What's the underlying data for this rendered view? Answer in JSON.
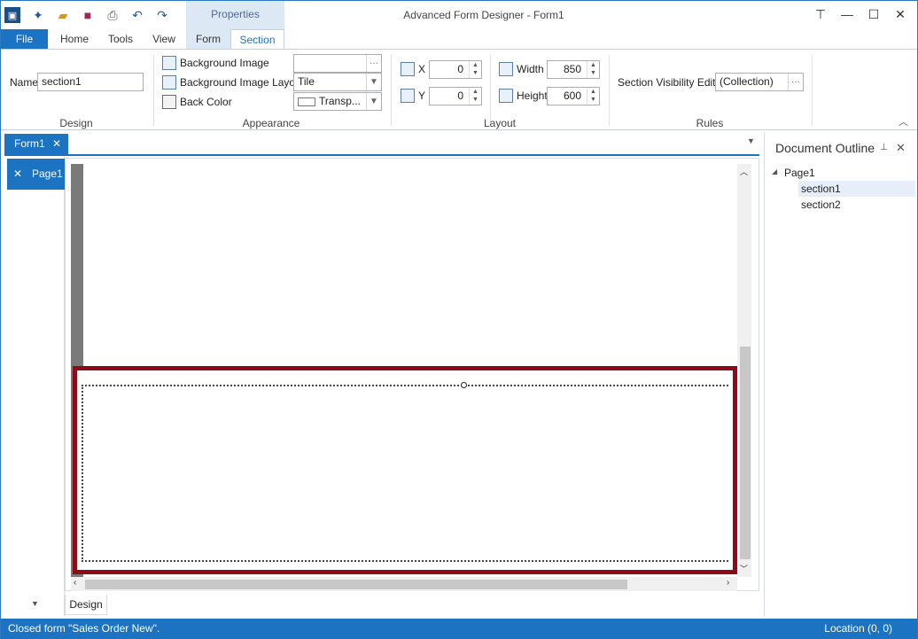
{
  "title": "Advanced Form Designer - Form1",
  "context_tab_header": "Properties",
  "tabs": {
    "file": "File",
    "home": "Home",
    "tools": "Tools",
    "view": "View",
    "form": "Form",
    "section": "Section"
  },
  "ribbon": {
    "design": {
      "label": "Design",
      "name_label": "Name",
      "name_value": "section1"
    },
    "appearance": {
      "label": "Appearance",
      "bg_image_label": "Background Image",
      "bg_image_value": "",
      "bg_layout_label": "Background Image Layout",
      "bg_layout_value": "Tile",
      "back_color_label": "Back Color",
      "back_color_value": "Transp..."
    },
    "layout": {
      "label": "Layout",
      "x_label": "X",
      "x_value": "0",
      "y_label": "Y",
      "y_value": "0",
      "width_label": "Width",
      "width_value": "850",
      "height_label": "Height",
      "height_value": "600"
    },
    "rules": {
      "label": "Rules",
      "visibility_label": "Section Visibility Editor",
      "visibility_value": "(Collection)"
    },
    "more_button": "···"
  },
  "document": {
    "tab": "Form1",
    "page_item": "Page1",
    "bottom_tab": "Design"
  },
  "outline": {
    "title": "Document Outline",
    "root": "Page1",
    "children": [
      "section1",
      "section2"
    ]
  },
  "status": {
    "left": "Closed form \"Sales Order New\".",
    "right": "Location (0, 0)"
  },
  "colors": {
    "accent": "#1b73c2",
    "selection_border": "#8b0c18"
  }
}
